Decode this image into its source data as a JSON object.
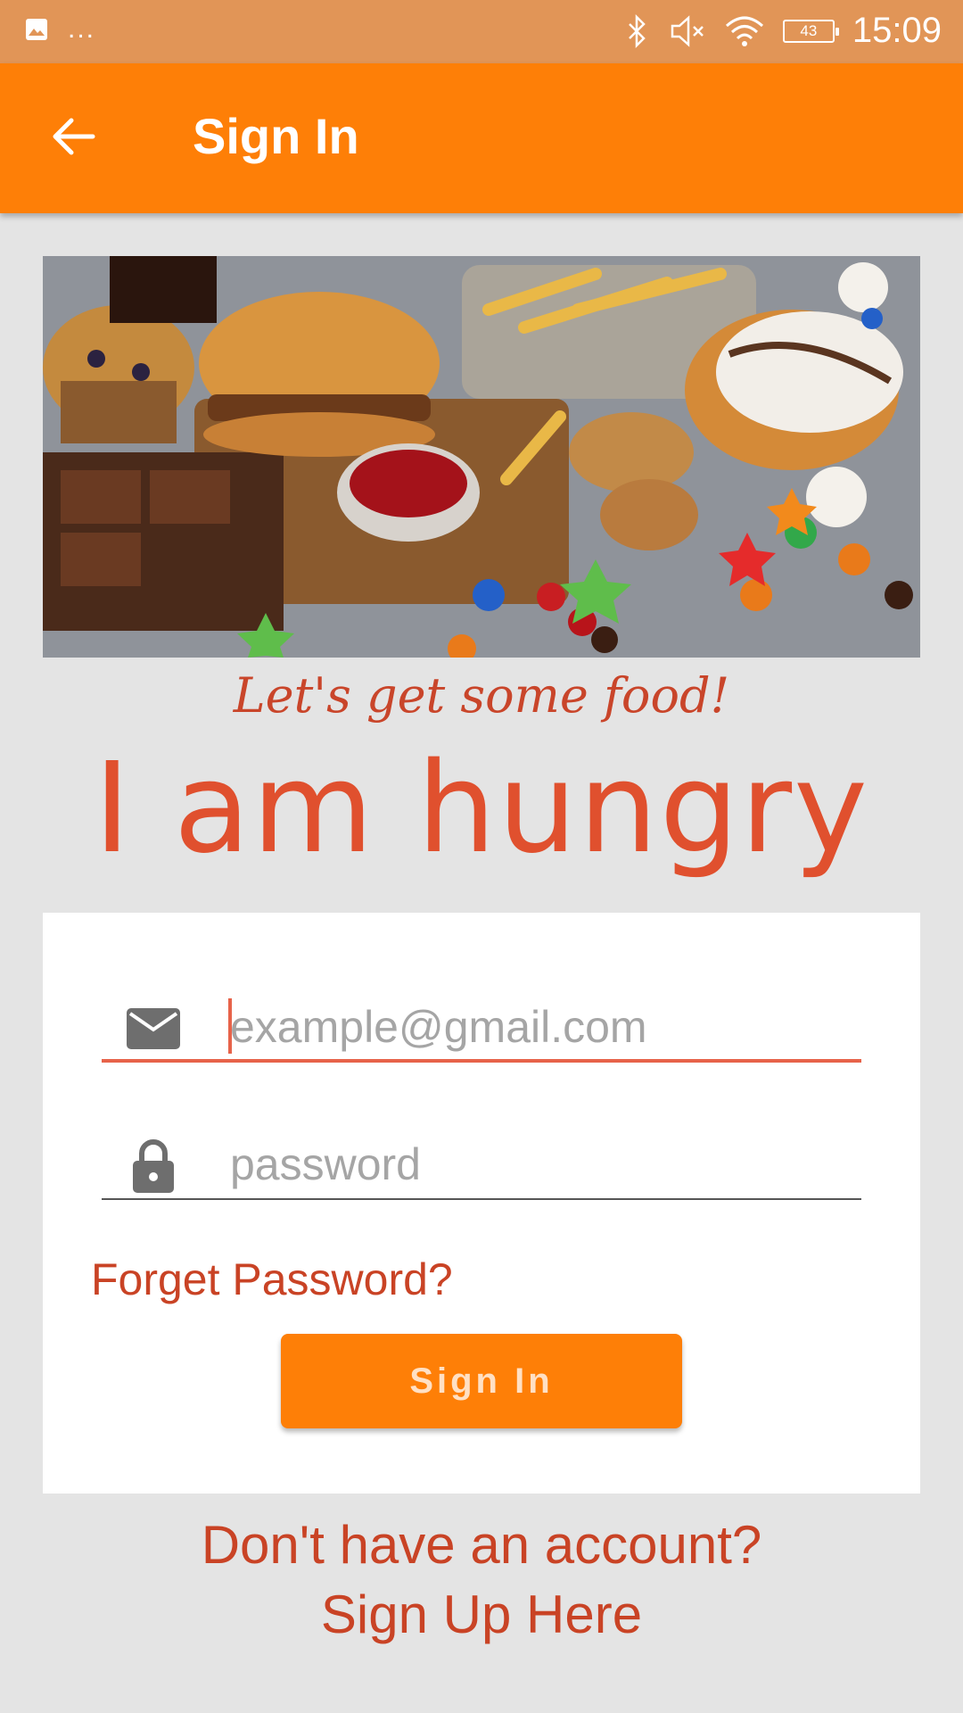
{
  "status_bar": {
    "icons": [
      "gallery-icon",
      "more-icon",
      "bluetooth-icon",
      "mute-icon",
      "wifi-icon"
    ],
    "more": "...",
    "battery": "43",
    "time": "15:09"
  },
  "app_bar": {
    "back_icon": "arrow-left-icon",
    "title": "Sign In"
  },
  "hero": {
    "tagline": "Let's get some food!",
    "brand": "I am hungry"
  },
  "form": {
    "email_placeholder": "example@gmail.com",
    "email_icon": "mail-icon",
    "password_placeholder": "password",
    "password_icon": "lock-icon",
    "forget_password": "Forget Password?",
    "sign_in_button": "Sign In"
  },
  "signup": {
    "line1": "Don't have an account?",
    "line2": "Sign Up Here"
  },
  "colors": {
    "status_bar": "#e19557",
    "app_bar": "#fe7f07",
    "accent_red": "#c94325",
    "background": "#e4e4e4"
  }
}
